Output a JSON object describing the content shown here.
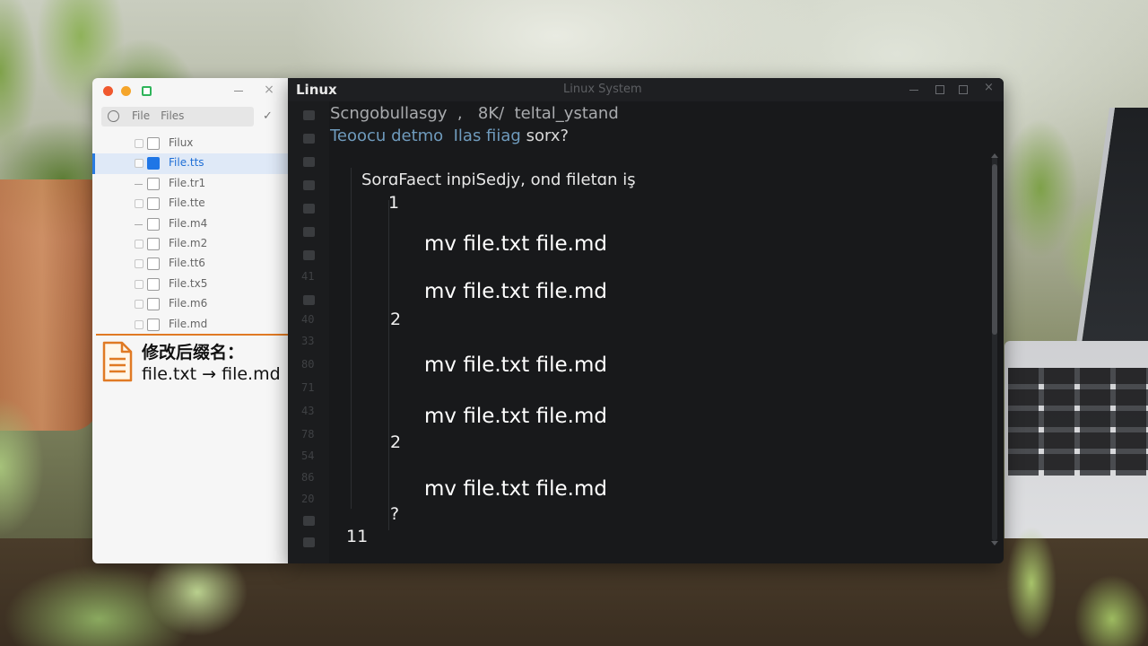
{
  "file_window": {
    "search_placeholder": "File Files",
    "check_glyph": "✓",
    "close_glyph": "×",
    "files": [
      {
        "name": "Filux",
        "selected": false
      },
      {
        "name": "File.tts",
        "selected": true
      },
      {
        "name": "File.tr1",
        "selected": false
      },
      {
        "name": "File.tte",
        "selected": false
      },
      {
        "name": "File.m4",
        "selected": false
      },
      {
        "name": "File.m2",
        "selected": false
      },
      {
        "name": "File.tt6",
        "selected": false
      },
      {
        "name": "File.tx5",
        "selected": false
      },
      {
        "name": "File.m6",
        "selected": false
      },
      {
        "name": "File.md",
        "selected": false
      }
    ]
  },
  "annotation": {
    "title": "修改后缀名：",
    "text": "file.txt → file.md",
    "color": "#e07a24"
  },
  "terminal": {
    "app_name": "Linux",
    "title": "Linux System",
    "close_glyph": "×",
    "header_line_1": "Scngobullasgy  ,   8K/  teltal_ystand",
    "header_line_2a": "Teoocu detmo  Ilas fiiag",
    "header_line_2b": " sorx?",
    "prompt": "SorɑFaect inpiSedjy, ond filetɑn iş",
    "gutter": [
      "41",
      "40",
      "33",
      "80",
      "71",
      "43",
      "78",
      "54",
      "86",
      "20"
    ],
    "blocks": [
      {
        "index": "1",
        "commands": [
          "mv file.txt file.md",
          "mv file.txt file.md"
        ]
      },
      {
        "index": "2",
        "commands": [
          "mv file.txt file.md",
          "mv file.txt file.md"
        ]
      },
      {
        "index": "2",
        "commands": [
          "mv file.txt file.md"
        ]
      },
      {
        "index": "?",
        "commands": []
      }
    ],
    "footer_number": "11"
  },
  "colors": {
    "terminal_bg": "#18191b",
    "file_window_bg": "#f6f6f6",
    "selection_blue": "#1f76e6",
    "accent_orange": "#e07a24"
  }
}
